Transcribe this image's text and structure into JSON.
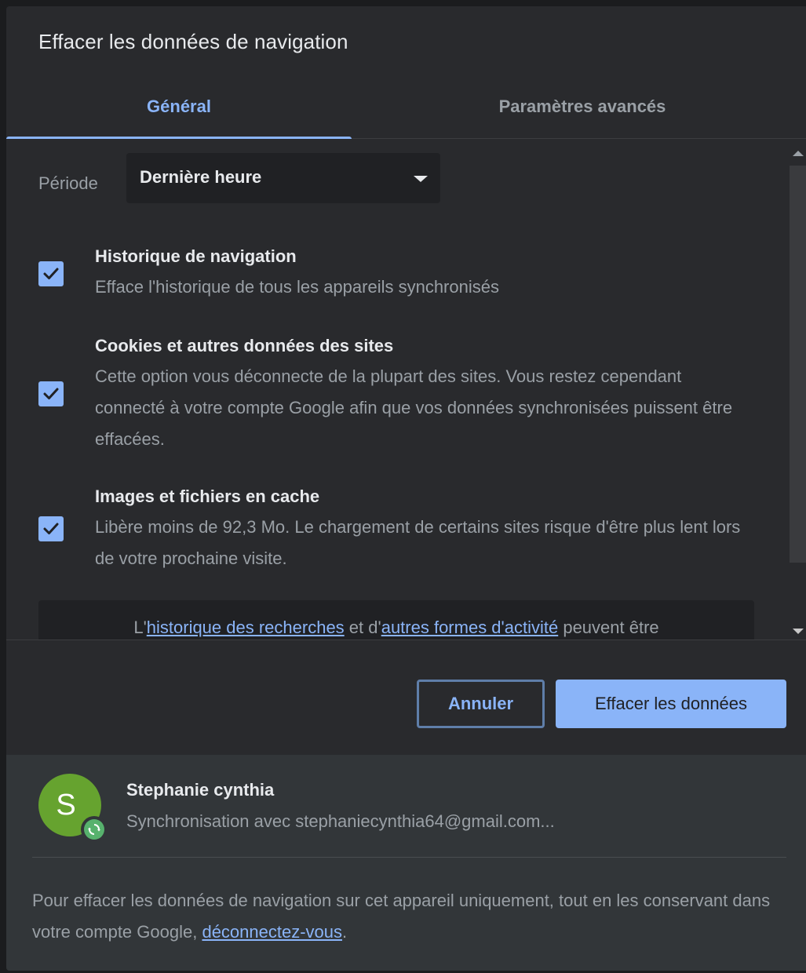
{
  "dialog": {
    "title": "Effacer les données de navigation"
  },
  "tabs": [
    {
      "label": "Général",
      "active": true
    },
    {
      "label": "Paramètres avancés",
      "active": false
    }
  ],
  "period": {
    "label": "Période",
    "value": "Dernière heure"
  },
  "options": [
    {
      "title": "Historique de navigation",
      "description": "Efface l'historique de tous les appareils synchronisés",
      "checked": true
    },
    {
      "title": "Cookies et autres données des sites",
      "description": "Cette option vous déconnecte de la plupart des sites. Vous restez cependant connecté à votre compte Google afin que vos données synchronisées puissent être effacées.",
      "checked": true
    },
    {
      "title": "Images et fichiers en cache",
      "description": "Libère moins de 92,3 Mo. Le chargement de certains sites risque d'être plus lent lors de votre prochaine visite.",
      "checked": true
    }
  ],
  "info": {
    "prefix": "L'",
    "link1": "historique des recherches",
    "middle": " et d'",
    "link2": "autres formes d'activité",
    "suffix": " peuvent être"
  },
  "buttons": {
    "cancel": "Annuler",
    "clear": "Effacer les données"
  },
  "account": {
    "initial": "S",
    "name": "Stephanie cynthia",
    "sync_text": "Synchronisation avec stephaniecynthia64@gmail.com..."
  },
  "footer": {
    "text": "Pour effacer les données de navigation sur cet appareil uniquement, tout en les conservant dans votre compte Google, ",
    "link": "déconnectez-vous",
    "suffix": "."
  },
  "colors": {
    "accent": "#8ab4f8",
    "dialog_bg": "#292a2d",
    "footer_bg": "#323639",
    "avatar": "#66a32f",
    "sync_badge": "#57b26d"
  }
}
